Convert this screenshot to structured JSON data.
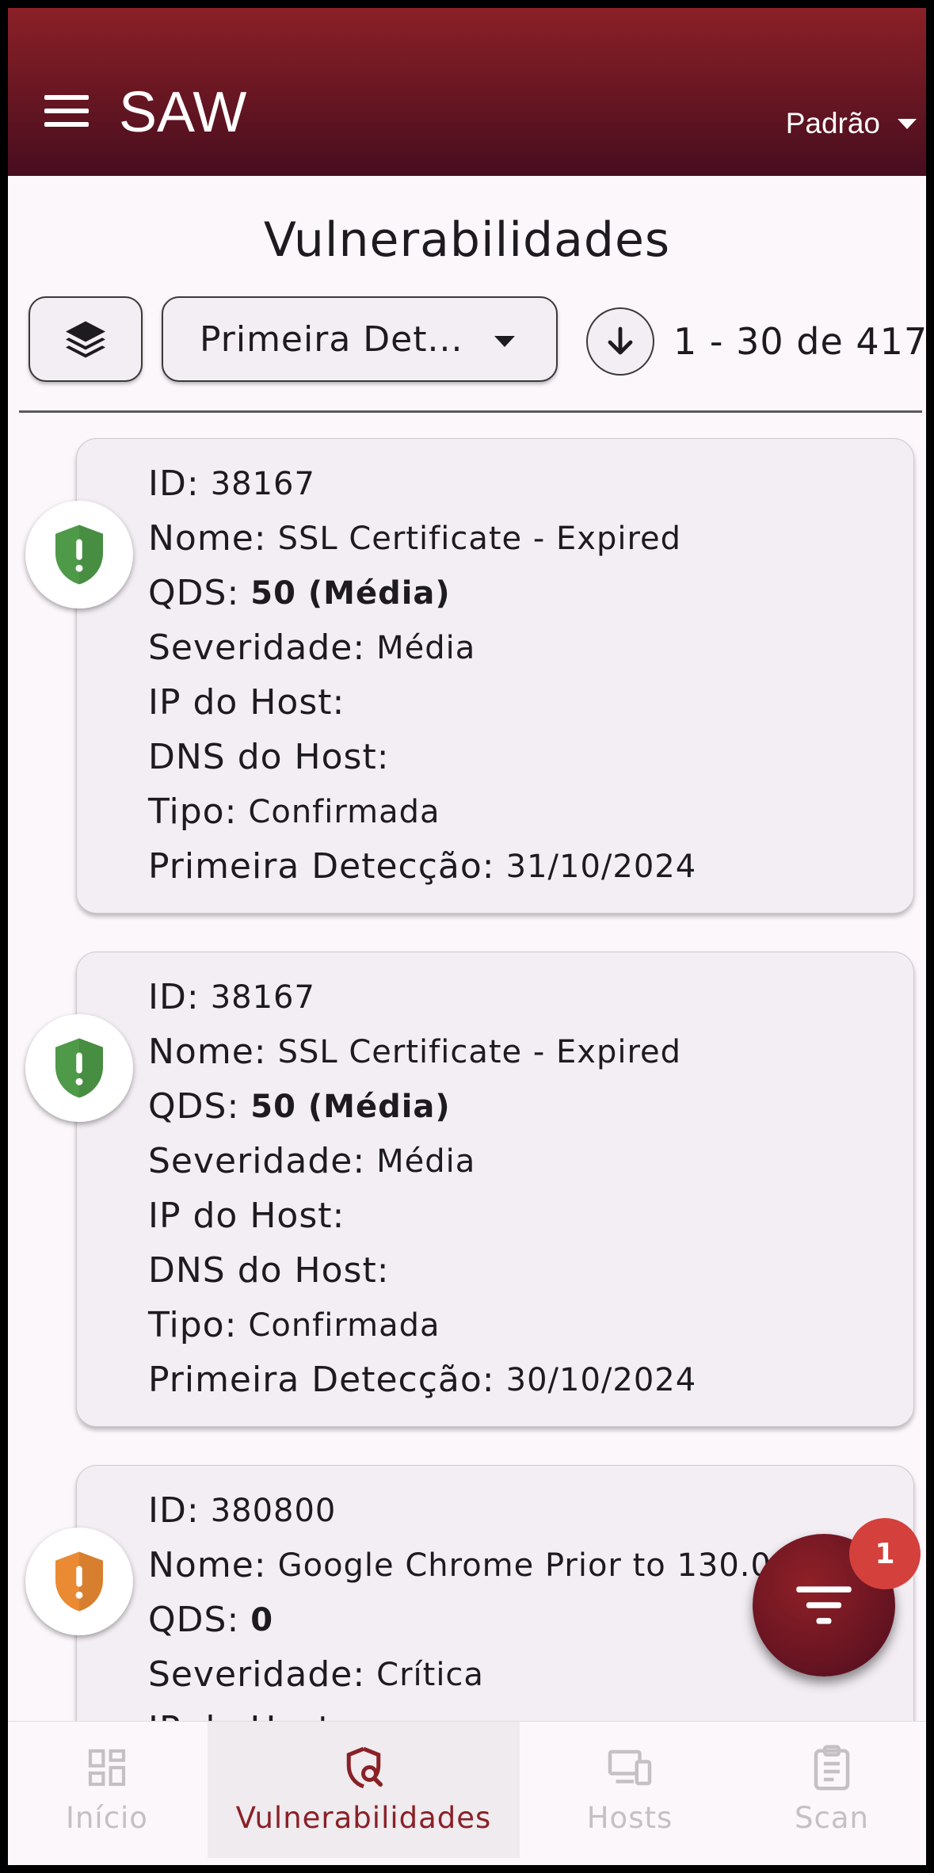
{
  "app_bar": {
    "title": "SAW",
    "profile_label": "Padrão"
  },
  "page": {
    "title": "Vulnerabilidades"
  },
  "toolbar": {
    "sort_field_label": "Primeira Det...",
    "pagination": "1 - 30 de 417"
  },
  "field_labels": {
    "id": "ID:",
    "name": "Nome:",
    "qds": "QDS:",
    "severity": "Severidade:",
    "host_ip": "IP do Host:",
    "host_dns": "DNS do Host:",
    "type": "Tipo:",
    "first_detection": "Primeira Detecção:"
  },
  "vulnerabilities": [
    {
      "id": "38167",
      "name": "SSL Certificate - Expired",
      "qds": "50 (Média)",
      "severity": "Média",
      "host_ip": "",
      "host_dns": "",
      "type": "Confirmada",
      "first_detection": "31/10/2024",
      "icon_color": "#4e9a48"
    },
    {
      "id": "38167",
      "name": "SSL Certificate - Expired",
      "qds": "50 (Média)",
      "severity": "Média",
      "host_ip": "",
      "host_dns": "",
      "type": "Confirmada",
      "first_detection": "30/10/2024",
      "icon_color": "#4e9a48"
    },
    {
      "id": "380800",
      "name": "Google Chrome Prior to 130.0.6",
      "qds": "0",
      "severity": "Crítica",
      "icon_color": "#ea8a32"
    }
  ],
  "filter": {
    "badge_count": "1"
  },
  "bottom_nav": {
    "items": [
      {
        "label": "Início",
        "icon": "grid-icon"
      },
      {
        "label": "Vulnerabilidades",
        "icon": "shield-search-icon"
      },
      {
        "label": "Hosts",
        "icon": "devices-icon"
      },
      {
        "label": "Scan",
        "icon": "clipboard-icon"
      }
    ]
  },
  "colors": {
    "brand": "#8a2027",
    "badge": "#d4403c",
    "medium_severity": "#4e9a48",
    "critical_severity": "#ea8a32"
  }
}
